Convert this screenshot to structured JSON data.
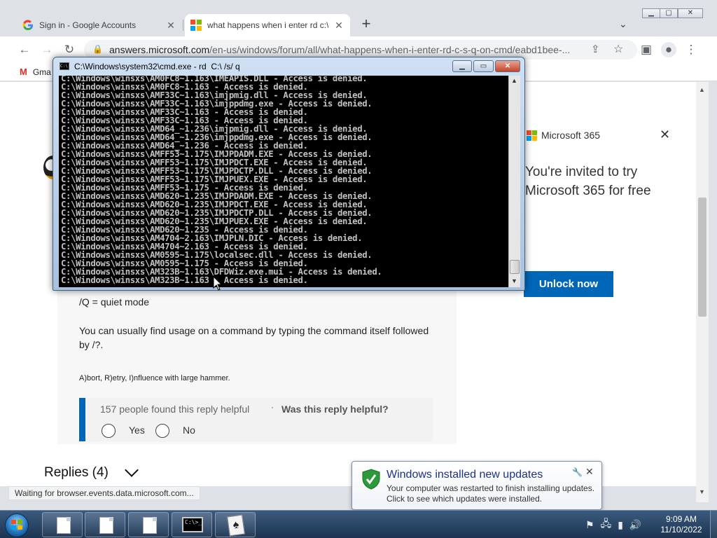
{
  "browser": {
    "tabs": [
      {
        "title": "Sign in - Google Accounts"
      },
      {
        "title": "what happens when i enter rd c:\\"
      }
    ],
    "new_tab": "+",
    "tab_list": "⌄",
    "url_host": "answers.microsoft.com",
    "url_path": "/en-us/windows/forum/all/what-happens-when-i-enter-rd-c-s-q-on-cmd/eabd1bee-...",
    "bookmark": "Gma",
    "left_edge_text": "M",
    "status": "Waiting for browser.events.data.microsoft.com..."
  },
  "page": {
    "promo": {
      "brand": "Microsoft 365",
      "heading": "You're invited to try Microsoft 365 for free",
      "button": "Unlock now",
      "close": "✕"
    },
    "answer": {
      "quiet_mode": "/Q = quiet mode",
      "usage": "You can usually find usage on a command by typing the command itself followed by /?.",
      "signature": "A)bort, R)etry, I)nfluence with large hammer."
    },
    "helpful": {
      "count_text": "157 people found this reply helpful",
      "separator": "·",
      "question": "Was this reply helpful?",
      "yes": "Yes",
      "no": "No"
    },
    "replies": "Replies (4)"
  },
  "cmd": {
    "title": "C:\\Windows\\system32\\cmd.exe - rd  C:\\ /s/ q",
    "lines": [
      "C:\\Windows\\winsxs\\AM0FC8~1.163\\IMEAPIS.DLL - Access is denied.",
      "C:\\Windows\\winsxs\\AM0FC8~1.163 - Access is denied.",
      "C:\\Windows\\winsxs\\AMF33C~1.163\\imjpmig.dll - Access is denied.",
      "C:\\Windows\\winsxs\\AMF33C~1.163\\imjppdmg.exe - Access is denied.",
      "C:\\Windows\\winsxs\\AMF33C~1.163 - Access is denied.",
      "C:\\Windows\\winsxs\\AMF33C~1.163 - Access is denied.",
      "C:\\Windows\\winsxs\\AMD64_~1.236\\imjpmig.dll - Access is denied.",
      "C:\\Windows\\winsxs\\AMD64_~1.236\\imjppdmg.exe - Access is denied.",
      "C:\\Windows\\winsxs\\AMD64_~1.236 - Access is denied.",
      "C:\\Windows\\winsxs\\AMFF53~1.175\\IMJPDADM.EXE - Access is denied.",
      "C:\\Windows\\winsxs\\AMFF53~1.175\\IMJPDCT.EXE - Access is denied.",
      "C:\\Windows\\winsxs\\AMFF53~1.175\\IMJPDCTP.DLL - Access is denied.",
      "C:\\Windows\\winsxs\\AMFF53~1.175\\IMJPUEX.EXE - Access is denied.",
      "C:\\Windows\\winsxs\\AMFF53~1.175 - Access is denied.",
      "C:\\Windows\\winsxs\\AMD620~1.235\\IMJPDADM.EXE - Access is denied.",
      "C:\\Windows\\winsxs\\AMD620~1.235\\IMJPDCT.EXE - Access is denied.",
      "C:\\Windows\\winsxs\\AMD620~1.235\\IMJPDCTP.DLL - Access is denied.",
      "C:\\Windows\\winsxs\\AMD620~1.235\\IMJPUEX.EXE - Access is denied.",
      "C:\\Windows\\winsxs\\AMD620~1.235 - Access is denied.",
      "C:\\Windows\\winsxs\\AM4704~2.163\\IMJPLN.DIC - Access is denied.",
      "C:\\Windows\\winsxs\\AM4704~2.163 - Access is denied.",
      "C:\\Windows\\winsxs\\AM0595~1.175\\localsec.dll - Access is denied.",
      "C:\\Windows\\winsxs\\AM0595~1.175 - Access is denied.",
      "C:\\Windows\\winsxs\\AM323B~1.163\\DFDWiz.exe.mui - Access is denied.",
      "C:\\Windows\\winsxs\\AM323B~1.163 - Access is denied."
    ]
  },
  "notification": {
    "title": "Windows installed new updates",
    "body": "Your computer was restarted to finish installing updates. Click to see which updates were installed."
  },
  "taskbar": {
    "cmd_icon_text": "C:\\>_",
    "clock_time": "9:09 AM",
    "clock_date": "11/10/2022"
  },
  "colors": {
    "accent": "#0067b8",
    "console_bg": "#000000",
    "console_text": "#c0c0c0"
  }
}
